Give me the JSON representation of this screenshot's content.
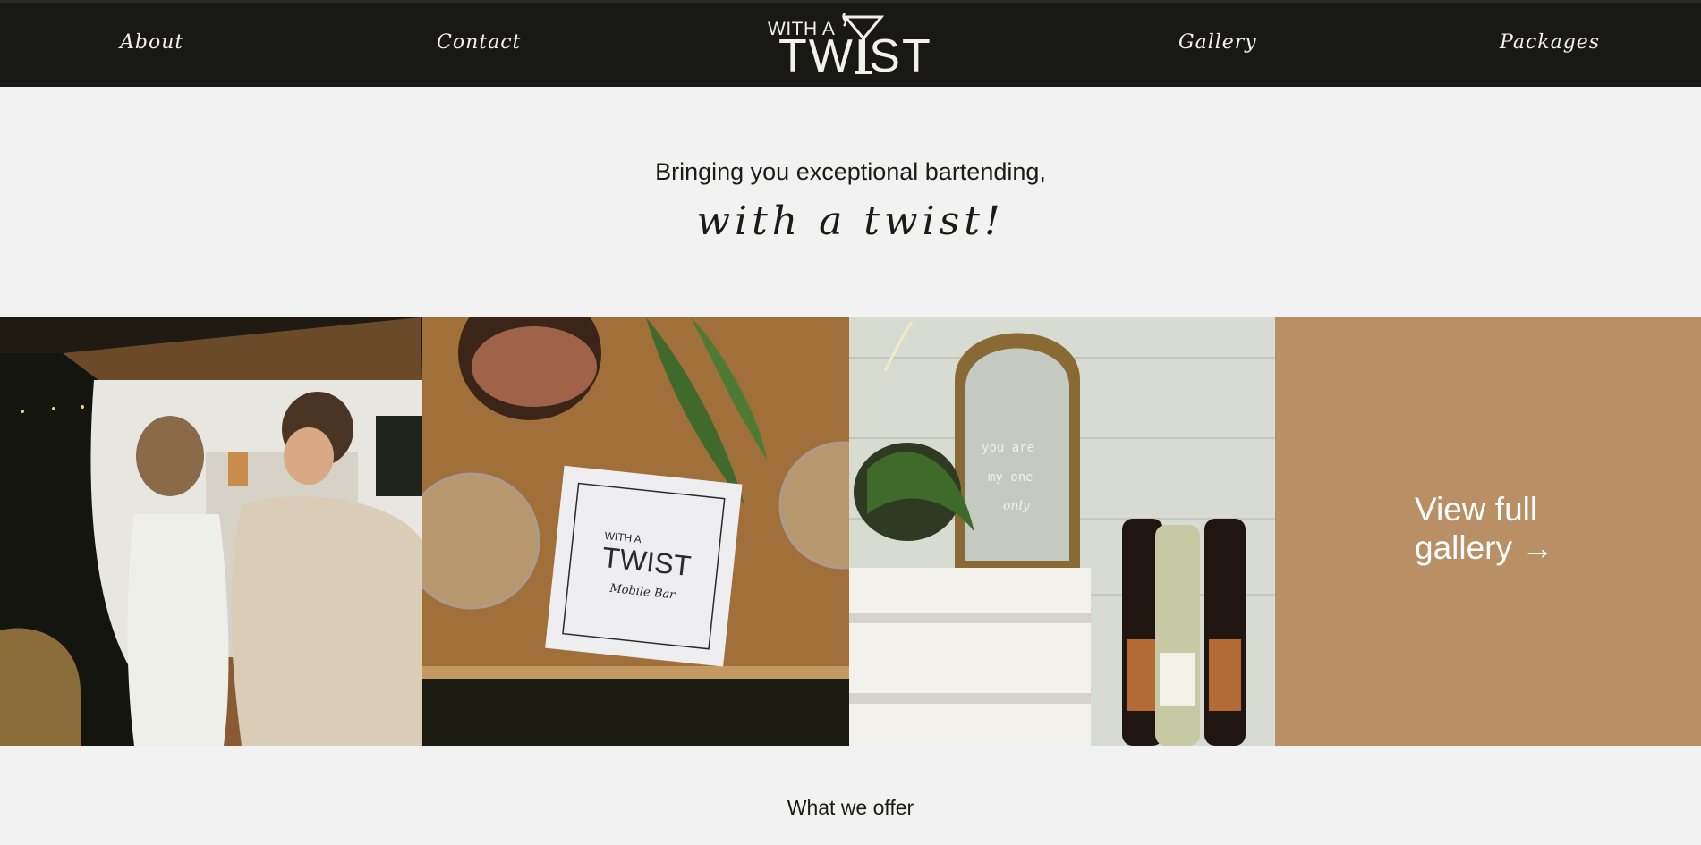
{
  "nav": {
    "about": "About",
    "contact": "Contact",
    "gallery": "Gallery",
    "packages": "Packages"
  },
  "logo": {
    "small": "WITH A",
    "big": "TWIST"
  },
  "hero": {
    "tagline": "Bringing you exceptional bartending,",
    "script": "with a twist!"
  },
  "gallery": {
    "view_full_line1": "View full",
    "view_full_line2": "gallery",
    "arrow": "→",
    "napkin_small": "WITH A",
    "napkin_big": "TWIST",
    "napkin_sub": "Mobile Bar",
    "mirror_text_1": "you are",
    "mirror_text_2": "my one",
    "mirror_text_3": "only"
  },
  "offer": {
    "heading": "What we offer"
  },
  "colors": {
    "nav_bg": "#181814",
    "page_bg": "#f2f2f2",
    "accent_tan": "#b98f66"
  }
}
